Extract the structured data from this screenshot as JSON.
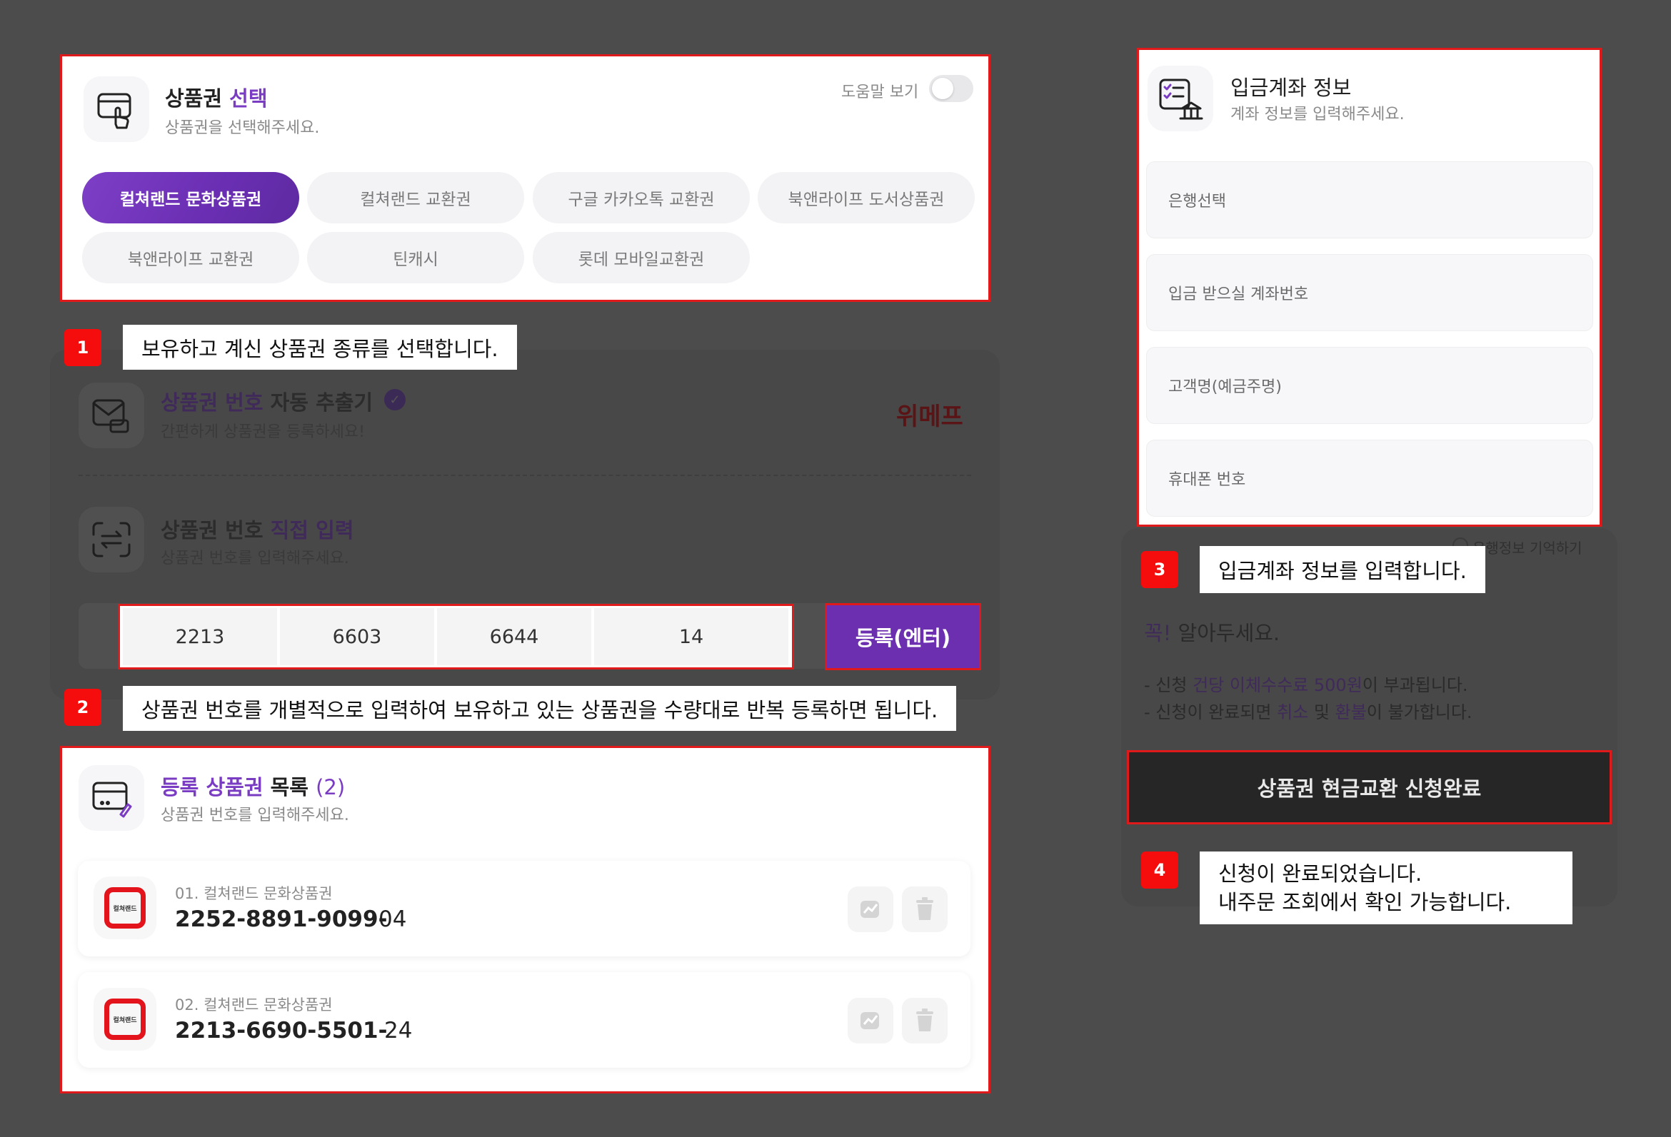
{
  "voucher_select": {
    "title_plain": "상품권",
    "title_accent": "선택",
    "subtitle": "상품권을 선택해주세요.",
    "help_toggle_label": "도움말 보기",
    "chips": [
      {
        "label": "컬쳐랜드 문화상품권",
        "active": true
      },
      {
        "label": "컬쳐랜드 교환권",
        "active": false
      },
      {
        "label": "구글 카카오톡 교환권",
        "active": false
      },
      {
        "label": "북앤라이프 도서상품권",
        "active": false
      },
      {
        "label": "북앤라이프 교환권",
        "active": false
      },
      {
        "label": "틴캐시",
        "active": false
      },
      {
        "label": "롯데 모바일교환권",
        "active": false
      }
    ]
  },
  "steps": [
    {
      "num": "1",
      "text": "보유하고 계신 상품권 종류를 선택합니다."
    },
    {
      "num": "2",
      "text": "상품권 번호를 개별적으로 입력하여 보유하고 있는 상품권을 수량대로 반복 등록하면 됩니다."
    },
    {
      "num": "3",
      "text": "입금계좌 정보를 입력합니다."
    },
    {
      "num": "4",
      "line1": "신청이 완료되었습니다.",
      "line2": "내주문 조회에서 확인 가능합니다."
    }
  ],
  "auto_extract": {
    "title_accent": "상품권 번호",
    "title_plain": "자동 추출기",
    "subtitle": "간편하게 상품권을 등록하세요!",
    "brand": "위메프"
  },
  "direct_input": {
    "title_plain": "상품권 번호",
    "title_accent": "직접 입력",
    "subtitle": "상품권 번호를 입력해주세요.",
    "codes": [
      "2213",
      "6603",
      "6644",
      "14"
    ],
    "register_label": "등록(엔터)"
  },
  "registered": {
    "title_accent": "등록 상품권",
    "title_plain": "목록",
    "count": "(2)",
    "subtitle": "상품권 번호를 입력해주세요.",
    "items": [
      {
        "label": "01.  컬쳐랜드 문화상품권",
        "code": "2252-8891-9099-",
        "tail": "04",
        "logo_text": "컬쳐랜드"
      },
      {
        "label": "02.  컬쳐랜드 문화상품권",
        "code": "2213-6690-5501-",
        "tail": "24",
        "logo_text": "컬쳐랜드"
      }
    ]
  },
  "account": {
    "title": "입금계좌 정보",
    "subtitle": "계좌 정보를 입력해주세요.",
    "fields": [
      "은행선택",
      "입금 받으실 계좌번호",
      "고객명(예금주명)",
      "휴대폰 번호"
    ],
    "remember_label": "은행정보 기억하기"
  },
  "notice": {
    "title_accent": "꼭!",
    "title_plain": "알아두세요.",
    "line1_a": "- 신청 ",
    "line1_b": "건당 이체수수료 500원",
    "line1_c": "이 부과됩니다.",
    "line2_a": "- 신청이 완료되면 ",
    "line2_b": "취소",
    "line2_c": " 및 ",
    "line2_d": "환불",
    "line2_e": "이 불가합니다."
  },
  "submit_label": "상품권 현금교환 신청완료",
  "colors": {
    "accent": "#7a3cc2",
    "highlight": "#e0191b",
    "badge": "#f50c0c"
  }
}
